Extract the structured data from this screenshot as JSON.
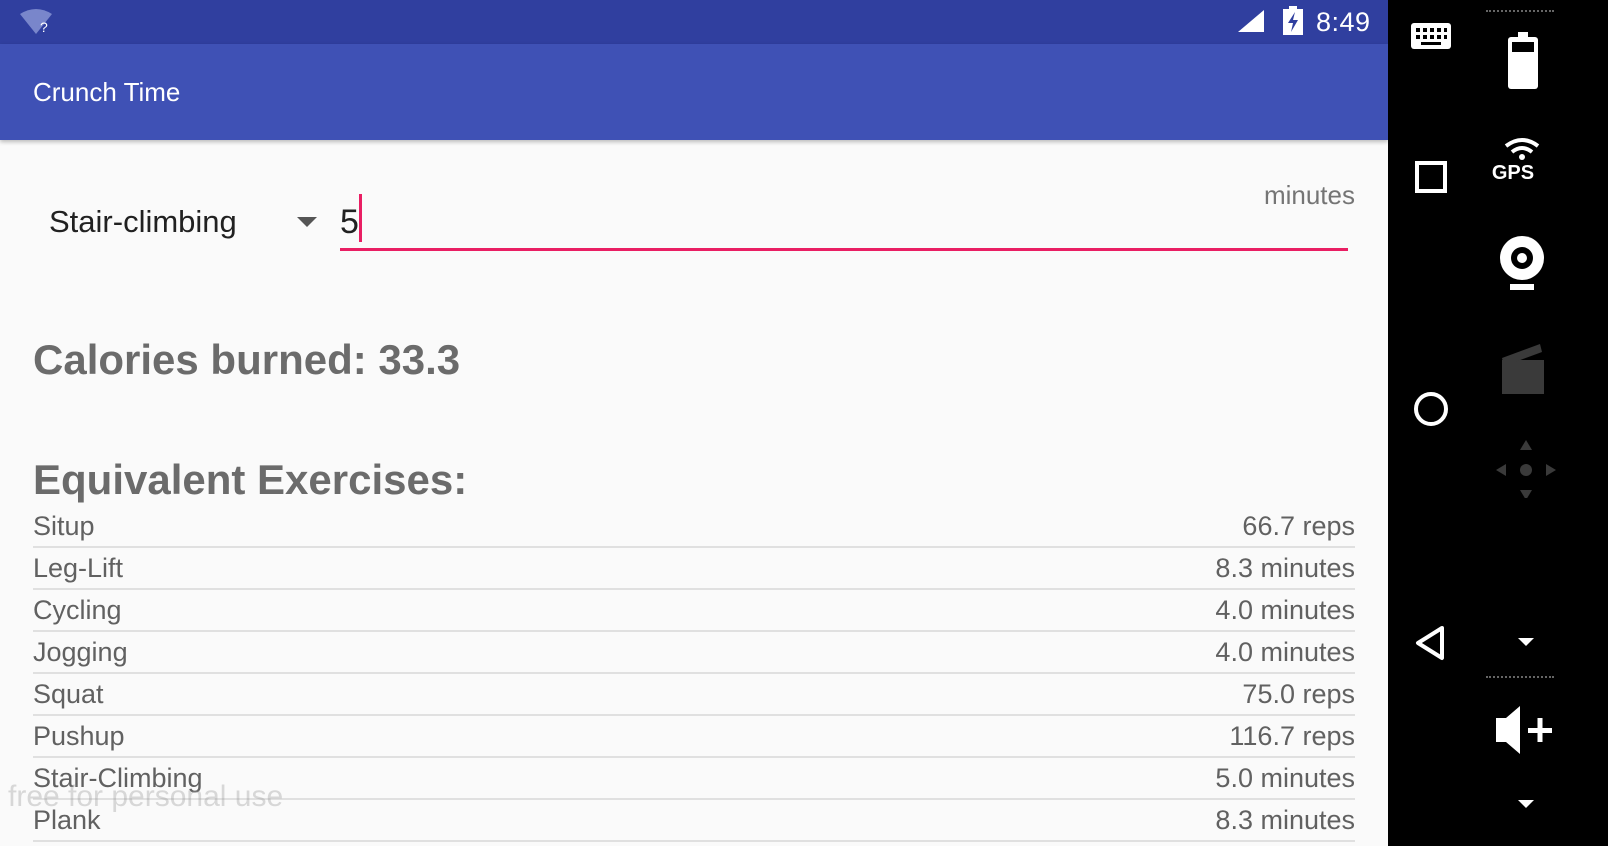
{
  "status_bar": {
    "time": "8:49",
    "wifi_icon": "wifi-unknown-icon",
    "signal_icon": "cell-signal-icon",
    "battery_icon": "battery-charging-icon"
  },
  "app_bar": {
    "title": "Crunch Time"
  },
  "form": {
    "exercise_selected": "Stair-climbing",
    "minutes_value": "5",
    "minutes_label": "minutes"
  },
  "calories": {
    "text": "Calories burned: 33.3"
  },
  "equivalents": {
    "heading": "Equivalent Exercises:",
    "rows": [
      {
        "name": "Situp",
        "amount": "66.7 reps"
      },
      {
        "name": "Leg-Lift",
        "amount": "8.3 minutes"
      },
      {
        "name": "Cycling",
        "amount": "4.0 minutes"
      },
      {
        "name": "Jogging",
        "amount": "4.0 minutes"
      },
      {
        "name": "Squat",
        "amount": "75.0 reps"
      },
      {
        "name": "Pushup",
        "amount": "116.7 reps"
      },
      {
        "name": "Stair-Climbing",
        "amount": "5.0 minutes"
      },
      {
        "name": "Plank",
        "amount": "8.3 minutes"
      }
    ]
  },
  "watermark": "free for personal use",
  "nav_bar": {
    "icons": [
      "keyboard-icon",
      "recents-icon",
      "home-icon",
      "back-icon"
    ]
  },
  "emulator_toolbar": {
    "gps_label": "GPS",
    "icons": [
      "battery-icon",
      "gps-icon",
      "camera-icon",
      "media-icon",
      "dpad-icon",
      "chevron-down-icon",
      "volume-up-icon"
    ]
  },
  "colors": {
    "status_bar": "#303f9f",
    "app_bar": "#3f51b5",
    "accent": "#e91e63",
    "background": "#fafafa"
  }
}
